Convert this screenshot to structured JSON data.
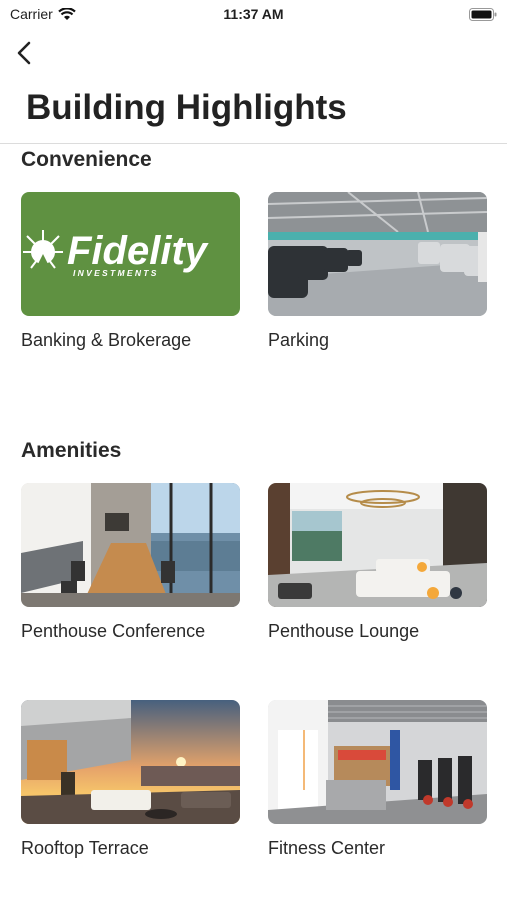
{
  "status_bar": {
    "carrier": "Carrier",
    "time": "11:37 AM"
  },
  "header": {
    "title": "Building Highlights"
  },
  "sections": [
    {
      "title": "Convenience",
      "items": [
        {
          "label": "Banking & Brokerage",
          "logo_main": "Fidelity",
          "logo_sub": "INVESTMENTS"
        },
        {
          "label": "Parking"
        }
      ]
    },
    {
      "title": "Amenities",
      "items": [
        {
          "label": "Penthouse Conference"
        },
        {
          "label": "Penthouse Lounge"
        },
        {
          "label": "Rooftop Terrace"
        },
        {
          "label": "Fitness Center"
        }
      ]
    }
  ],
  "colors": {
    "fidelity_green": "#5f9141",
    "accent_orange": "#f4a83a"
  }
}
